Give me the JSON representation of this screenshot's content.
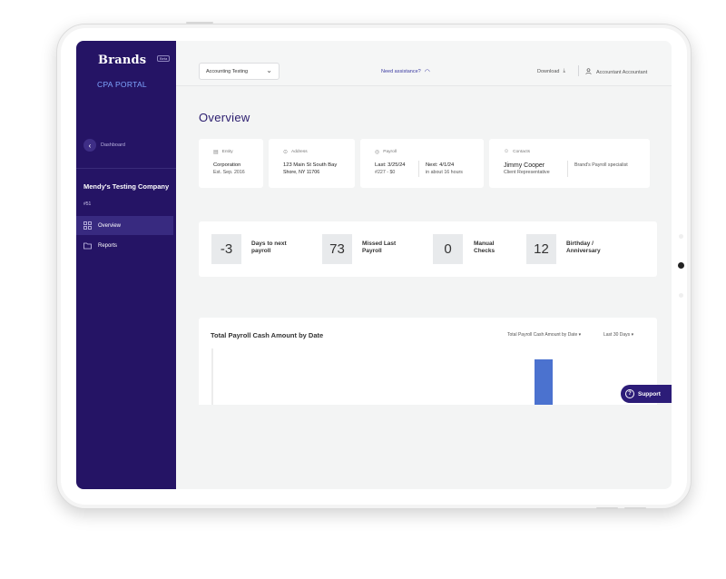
{
  "sidebar": {
    "logo": "Brands",
    "beta": "Beta",
    "portal_title": "CPA PORTAL",
    "back_label": "Dashboard",
    "company_name": "Mendy's Testing Company",
    "company_id": "#51",
    "items": [
      {
        "label": "Overview",
        "icon": "grid-icon",
        "active": true
      },
      {
        "label": "Reports",
        "icon": "folder-icon",
        "active": false
      }
    ]
  },
  "header": {
    "company_select": "Accounting Testing",
    "assistance": "Need assistance?",
    "download": "Download",
    "user": "Accountant Accountant"
  },
  "page_title": "Overview",
  "info_cards": {
    "entity": {
      "label": "Entity",
      "line1": "Corporation",
      "line2": "Est. Sep. 2016"
    },
    "address": {
      "label": "Address",
      "line1": "123 Main St South Bay",
      "line2": "Shore, NY 11706"
    },
    "payroll": {
      "label": "Payroll",
      "last1": "Last: 3/25/24",
      "last2": "#227 - $0",
      "next1": "Next: 4/1/24",
      "next2": "in about 16 hours"
    },
    "contacts": {
      "label": "Contacts",
      "name": "Jimmy Cooper",
      "role": "Client Representative",
      "specialist": "Brand's Payroll specialist"
    }
  },
  "stats": [
    {
      "value": "-3",
      "label1": "Days to next",
      "label2": "payroll"
    },
    {
      "value": "73",
      "label1": "Missed Last",
      "label2": "Payroll"
    },
    {
      "value": "0",
      "label1": "Manual",
      "label2": "Checks"
    },
    {
      "value": "12",
      "label1": "Birthday /",
      "label2": "Anniversary"
    }
  ],
  "chart": {
    "title": "Total Payroll Cash Amount by Date",
    "metric_select": "Total Payroll Cash Amount by Date",
    "range_select": "Last 30 Days"
  },
  "chart_data": {
    "type": "bar",
    "title": "Total Payroll Cash Amount by Date",
    "categories": [
      "",
      ""
    ],
    "values": [
      0,
      1
    ],
    "bar_color": "#4b72cf",
    "grid": false
  },
  "support": "Support",
  "colors": {
    "sidebar": "#251465",
    "accent": "#2a1c6e",
    "bar": "#4b72cf",
    "link": "#7fa6ff"
  }
}
